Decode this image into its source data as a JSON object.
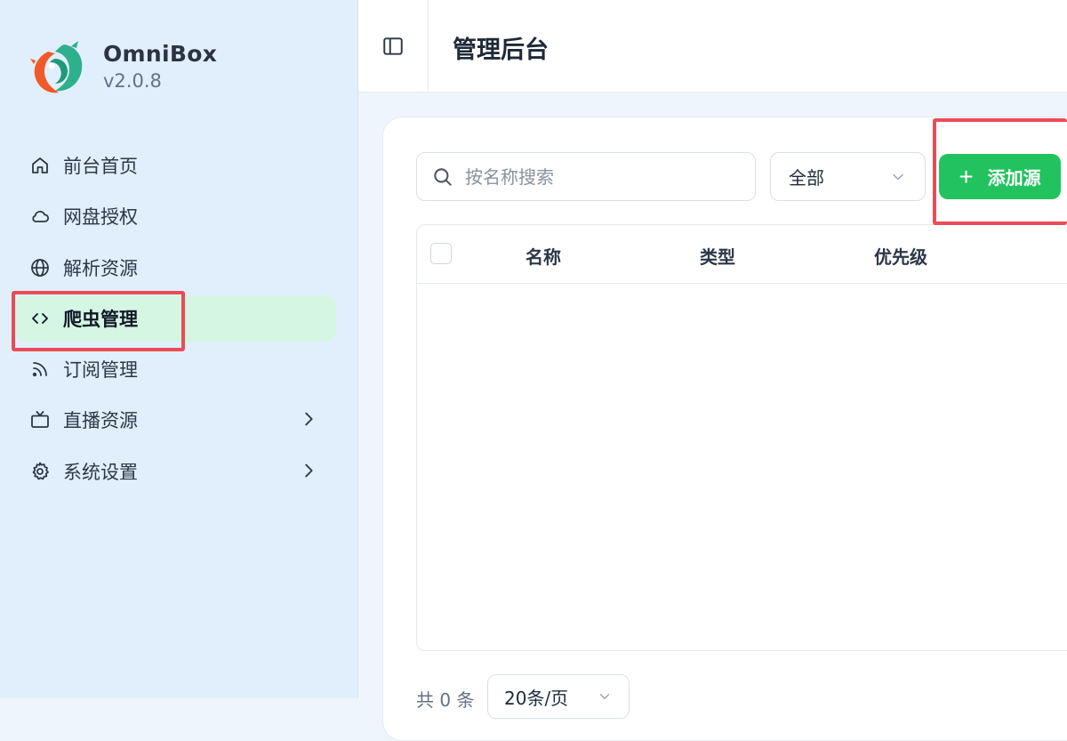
{
  "brand": {
    "name": "OmniBox",
    "version": "v2.0.8"
  },
  "sidebar": {
    "items": [
      {
        "label": "前台首页",
        "icon": "home-icon"
      },
      {
        "label": "网盘授权",
        "icon": "cloud-icon"
      },
      {
        "label": "解析资源",
        "icon": "globe-icon"
      },
      {
        "label": "爬虫管理",
        "icon": "code-icon",
        "active": true
      },
      {
        "label": "订阅管理",
        "icon": "rss-icon"
      },
      {
        "label": "直播资源",
        "icon": "tv-icon",
        "expandable": true
      },
      {
        "label": "系统设置",
        "icon": "gear-icon",
        "expandable": true
      }
    ]
  },
  "header": {
    "title": "管理后台"
  },
  "toolbar": {
    "search_placeholder": "按名称搜索",
    "filter_value": "全部",
    "add_label": "添加源"
  },
  "table": {
    "columns": [
      "名称",
      "类型",
      "优先级"
    ],
    "rows": []
  },
  "footer": {
    "total": "共 0 条",
    "page_size": "20条/页"
  },
  "colors": {
    "accent": "#22c35e",
    "active_bg": "#d4f6e3",
    "highlight": "#ea4c55"
  }
}
